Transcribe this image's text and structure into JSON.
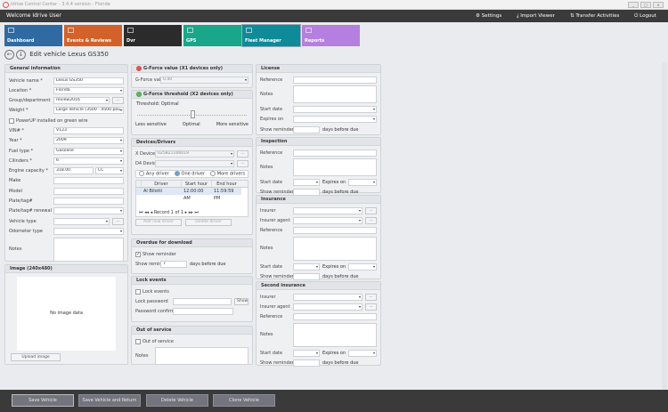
{
  "window": {
    "title": "Idrive Control Center - 3.4.4 version - Florida"
  },
  "header": {
    "welcome": "Welcome Idrive User",
    "links": [
      {
        "icon": "gears-icon",
        "label": "Settings"
      },
      {
        "icon": "download-icon",
        "label": "Import Viewer"
      },
      {
        "icon": "transfer-icon",
        "label": "Transfer Activities"
      },
      {
        "icon": "power-icon",
        "label": "Logout"
      }
    ]
  },
  "tiles": [
    {
      "label": "Dashboard",
      "color": "#2f6aa3"
    },
    {
      "label": "Events & Reviews",
      "color": "#d2622a"
    },
    {
      "label": "Dvr",
      "color": "#2b2b2b"
    },
    {
      "label": "GPS",
      "color": "#1aa68a"
    },
    {
      "label": "Fleet Manager",
      "color": "#0e8a99",
      "active": true
    },
    {
      "label": "Reports",
      "color": "#b57fe0"
    }
  ],
  "page": {
    "title": "Edit vehicle Lexus GS350"
  },
  "panels": {
    "general": {
      "title": "General information",
      "rows": [
        {
          "label": "Vehicle name *",
          "type": "text",
          "value": "Lexus GS350"
        },
        {
          "label": "Location *",
          "type": "select",
          "value": "Florida"
        },
        {
          "label": "Group/department",
          "type": "select-btn",
          "value": "review2016",
          "button": "..."
        },
        {
          "label": "Weight *",
          "type": "select",
          "value": "Large Vehicle (3500 - 4500 pou..."
        },
        {
          "label": "PowerUP installed on green wire",
          "type": "check",
          "checked": false
        },
        {
          "label": "VIN# *",
          "type": "text",
          "value": "V123"
        },
        {
          "label": "Year *",
          "type": "select",
          "value": "2009"
        },
        {
          "label": "Fuel type *",
          "type": "select",
          "value": "Gasoline"
        },
        {
          "label": "Cilinders *",
          "type": "select",
          "value": "6"
        },
        {
          "label": "Engine capacity *",
          "type": "text-unit",
          "value": "318.00",
          "unit": "CC"
        },
        {
          "label": "Make",
          "type": "text",
          "value": ""
        },
        {
          "label": "Model",
          "type": "text",
          "value": ""
        },
        {
          "label": "Plate/tag#",
          "type": "text",
          "value": ""
        },
        {
          "label": "Plate/tag# renewal",
          "type": "select",
          "value": ""
        },
        {
          "label": "Vehicle type",
          "type": "select-btn",
          "value": "",
          "button": "..."
        },
        {
          "label": "Odometer type",
          "type": "select",
          "value": ""
        },
        {
          "label": "Notes",
          "type": "textarea",
          "value": ""
        }
      ]
    },
    "image": {
      "title": "Image (240x480)",
      "placeholder": "No image data",
      "upload": "Upload image"
    },
    "gforce_value": {
      "title": "G-Force value (X1 devices only)",
      "status_color": "#d9534f",
      "rows": [
        {
          "label": "G-Force value",
          "type": "select",
          "value": "0.40",
          "disabled": true
        }
      ]
    },
    "gforce_threshold": {
      "title": "G-Force threshold (X2 devices only)",
      "status_color": "#5cb85c",
      "threshold_label": "Threshold: Optimal",
      "slider_level": 0.5,
      "scale": [
        "Less sensitive",
        "Optimal",
        "More sensitive"
      ]
    },
    "devices": {
      "title": "Devices/Drivers",
      "rows": [
        {
          "label": "X Device",
          "type": "select-btn",
          "value": "025821100019",
          "button": "...",
          "disabled": true
        },
        {
          "label": "D4 Device",
          "type": "select-btn",
          "value": "",
          "button": "...",
          "disabled": true
        }
      ],
      "radios": [
        {
          "label": "Any driver",
          "selected": false
        },
        {
          "label": "One driver",
          "selected": true
        },
        {
          "label": "More drivers",
          "selected": false
        }
      ],
      "grid": {
        "columns": [
          "Driver",
          "Start hour",
          "End hour"
        ],
        "rows": [
          [
            "Al Bilotti",
            "12:00:00 AM",
            "11:59:59 PM"
          ]
        ]
      },
      "pager": "Record 1 of 1",
      "add": "Add new driver",
      "delete": "Delete driver"
    },
    "overdue": {
      "title": "Overdue for download",
      "rows": [
        {
          "label": "Show reminder",
          "type": "check",
          "checked": true
        },
        {
          "label": "Show reminder",
          "type": "reminder",
          "value": "7",
          "suffix": "days before due"
        }
      ]
    },
    "lock": {
      "title": "Lock events",
      "rows": [
        {
          "label": "Lock events",
          "type": "check",
          "checked": false
        },
        {
          "label": "Lock password",
          "type": "text-btn",
          "value": "",
          "button": "Show"
        },
        {
          "label": "Password confirm",
          "type": "text-short",
          "value": ""
        }
      ]
    },
    "outofservice": {
      "title": "Out of service",
      "rows": [
        {
          "label": "Out of service",
          "type": "check",
          "checked": false
        },
        {
          "label": "Notes",
          "type": "textarea-s",
          "value": ""
        }
      ]
    },
    "license": {
      "title": "License",
      "rows": [
        {
          "label": "Reference",
          "type": "text",
          "value": ""
        },
        {
          "label": "Notes",
          "type": "textarea-s",
          "value": ""
        },
        {
          "label": "Start date",
          "type": "select",
          "value": ""
        },
        {
          "label": "Expires on",
          "type": "select",
          "value": ""
        },
        {
          "label": "Show reminder",
          "type": "reminder",
          "value": "",
          "suffix": "days before due"
        }
      ]
    },
    "inspection": {
      "title": "Inspection",
      "rows": [
        {
          "label": "Reference",
          "type": "text",
          "value": ""
        },
        {
          "label": "Notes",
          "type": "textarea-s",
          "value": ""
        },
        {
          "label": "Start date",
          "type": "dates",
          "value": "",
          "label2": "Expires on"
        },
        {
          "label": "Show reminder",
          "type": "reminder",
          "value": "",
          "suffix": "days before due"
        }
      ]
    },
    "insurance": {
      "title": "Insurance",
      "rows": [
        {
          "label": "Insurer",
          "type": "select-btn",
          "value": "",
          "button": "..."
        },
        {
          "label": "Insurer agent",
          "type": "select-btn",
          "value": "",
          "button": "..."
        },
        {
          "label": "Reference",
          "type": "text",
          "value": ""
        },
        {
          "label": "Notes",
          "type": "textarea",
          "value": ""
        },
        {
          "label": "Start date",
          "type": "dates",
          "value": "",
          "label2": "Expires on"
        },
        {
          "label": "Show reminder",
          "type": "reminder",
          "value": "",
          "suffix": "days before due"
        }
      ]
    },
    "second_insurance": {
      "title": "Second insurance",
      "rows": [
        {
          "label": "Insurer",
          "type": "select-btn",
          "value": "",
          "button": "..."
        },
        {
          "label": "Insurer agent",
          "type": "select-btn",
          "value": "",
          "button": "..."
        },
        {
          "label": "Reference",
          "type": "text",
          "value": ""
        },
        {
          "label": "Notes",
          "type": "textarea",
          "value": ""
        },
        {
          "label": "Start date",
          "type": "dates",
          "value": "",
          "label2": "Expires on"
        },
        {
          "label": "Show reminder",
          "type": "reminder",
          "value": "",
          "suffix": "days before due"
        }
      ]
    }
  },
  "footer": {
    "buttons": [
      "Save Vehicle",
      "Save Vehicle and Return",
      "Delete Vehicle",
      "Clone Vehicle"
    ]
  }
}
